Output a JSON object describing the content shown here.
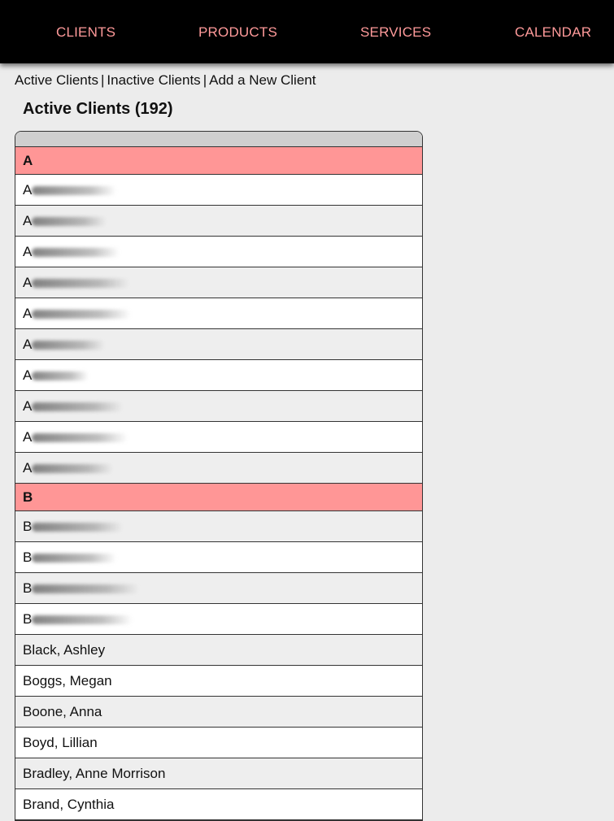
{
  "nav": {
    "items": [
      "CLIENTS",
      "PRODUCTS",
      "SERVICES",
      "CALENDAR"
    ]
  },
  "subnav": {
    "active": "Active Clients",
    "inactive": "Inactive Clients",
    "add_new": "Add a New Client",
    "separator": "|"
  },
  "heading": "Active Clients (192)",
  "colors": {
    "nav_bg": "#000000",
    "nav_text": "#ff9a9a",
    "letter_row": "#ff9696"
  },
  "groups": [
    {
      "letter": "A",
      "clients": [
        "A",
        "A",
        "A",
        "A",
        "A",
        "A",
        "A",
        "A",
        "A",
        "A"
      ]
    },
    {
      "letter": "B",
      "clients": [
        "B",
        "B",
        "B",
        "B",
        "Black, Ashley",
        "Boggs, Megan",
        "Boone, Anna",
        "Boyd, Lillian",
        "Bradley, Anne Morrison",
        "Brand, Cynthia"
      ]
    }
  ]
}
